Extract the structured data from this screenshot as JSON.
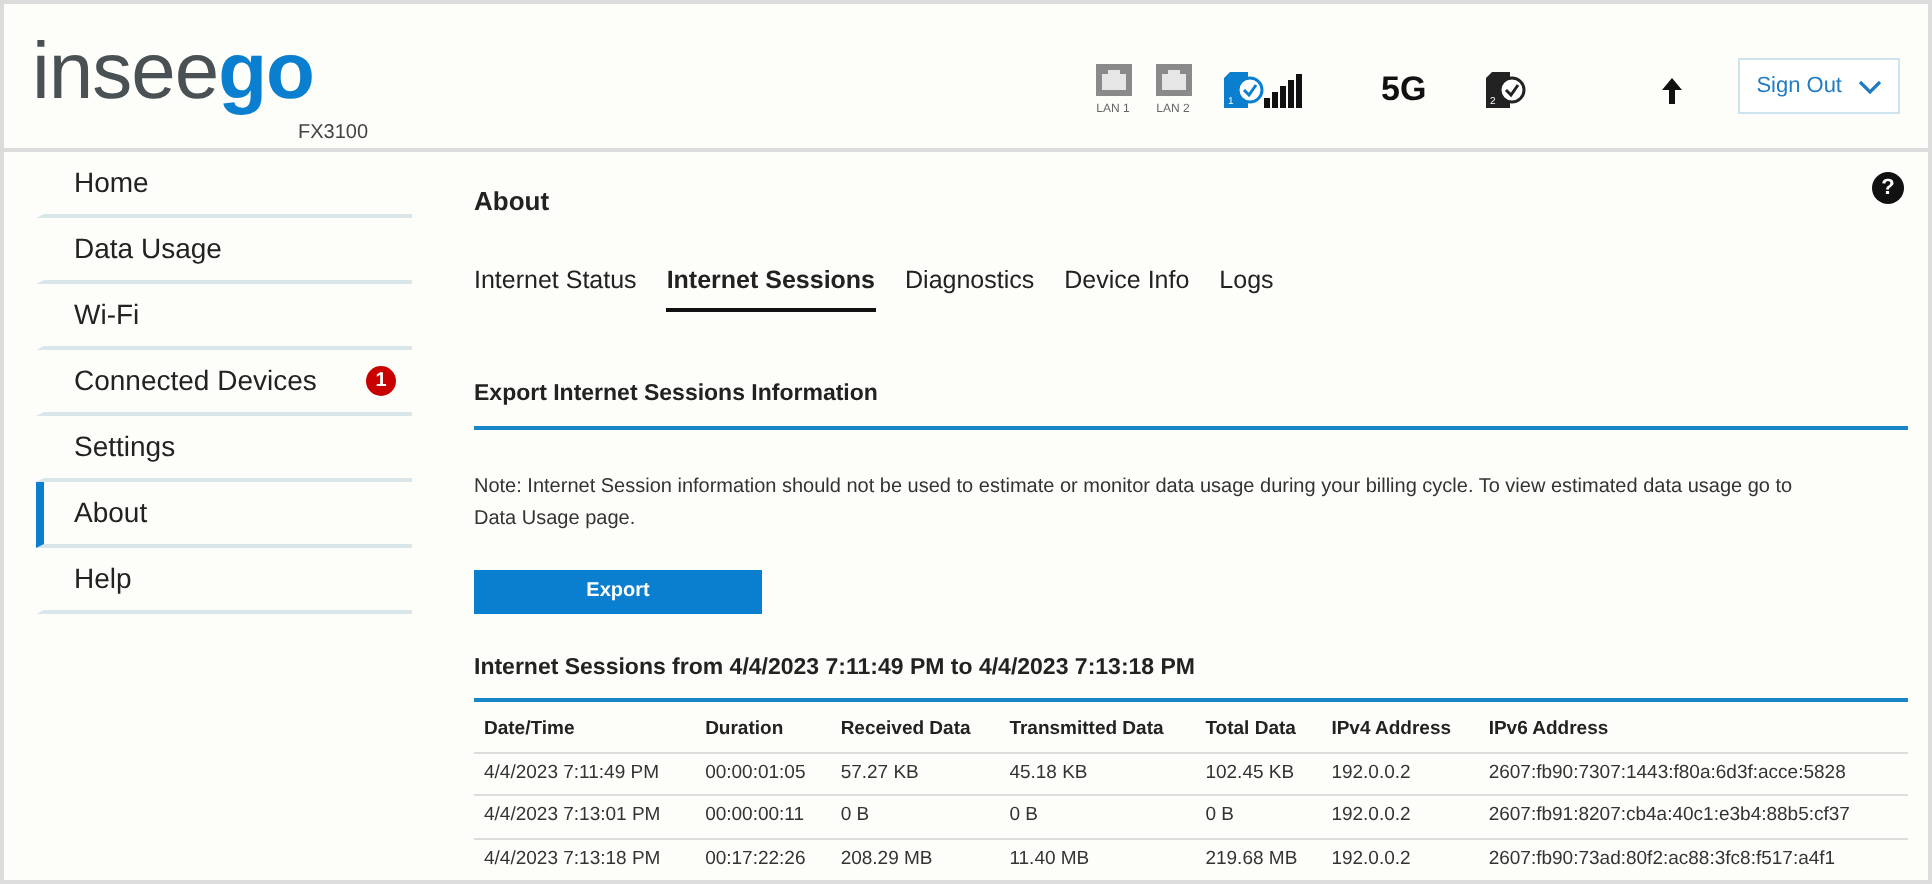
{
  "header": {
    "logo": {
      "text": "insee",
      "accent": "go"
    },
    "model": "FX3100",
    "status": [
      {
        "kind": "lan",
        "label": "LAN 1"
      },
      {
        "kind": "lan",
        "label": "LAN 2"
      },
      {
        "kind": "sim",
        "slot": "1",
        "active": true
      },
      {
        "kind": "signal"
      },
      {
        "kind": "text",
        "label": "5G"
      },
      {
        "kind": "sim",
        "slot": "2",
        "active": false
      },
      {
        "kind": "upload"
      }
    ],
    "sign_out": "Sign Out"
  },
  "sidebar": {
    "items": [
      {
        "label": "Home",
        "selected": false
      },
      {
        "label": "Data Usage",
        "selected": false
      },
      {
        "label": "Wi-Fi",
        "selected": false
      },
      {
        "label": "Connected Devices",
        "selected": false,
        "badge": "1"
      },
      {
        "label": "Settings",
        "selected": false
      },
      {
        "label": "About",
        "selected": true
      },
      {
        "label": "Help",
        "selected": false
      }
    ]
  },
  "page_title": "About",
  "help": "?",
  "tabs": [
    {
      "label": "Internet Status",
      "selected": false
    },
    {
      "label": "Internet Sessions",
      "selected": true
    },
    {
      "label": "Diagnostics",
      "selected": false
    },
    {
      "label": "Device Info",
      "selected": false
    },
    {
      "label": "Logs",
      "selected": false
    }
  ],
  "export_section": {
    "title": "Export Internet Sessions Information",
    "note": "Note: Internet Session information should not be used to estimate or monitor data usage during your billing cycle. To view estimated data usage go to Data Usage page.",
    "button": "Export"
  },
  "sessions": {
    "title": "Internet Sessions from 4/4/2023 7:11:49 PM to 4/4/2023 7:13:18 PM",
    "columns": [
      "Date/Time",
      "Duration",
      "Received Data",
      "Transmitted Data",
      "Total Data",
      "IPv4 Address",
      "IPv6 Address"
    ],
    "rows": [
      [
        "4/4/2023 7:11:49 PM",
        "00:00:01:05",
        "57.27 KB",
        "45.18 KB",
        "102.45 KB",
        "192.0.0.2",
        "2607:fb90:7307:1443:f80a:6d3f:acce:5828"
      ],
      [
        "4/4/2023 7:13:01 PM",
        "00:00:00:11",
        "0 B",
        "0 B",
        "0 B",
        "192.0.0.2",
        "2607:fb91:8207:cb4a:40c1:e3b4:88b5:cf37"
      ],
      [
        "4/4/2023 7:13:18 PM",
        "00:17:22:26",
        "208.29 MB",
        "11.40 MB",
        "219.68 MB",
        "192.0.0.2",
        "2607:fb90:73ad:80f2:ac88:3fc8:f517:a4f1"
      ]
    ]
  }
}
